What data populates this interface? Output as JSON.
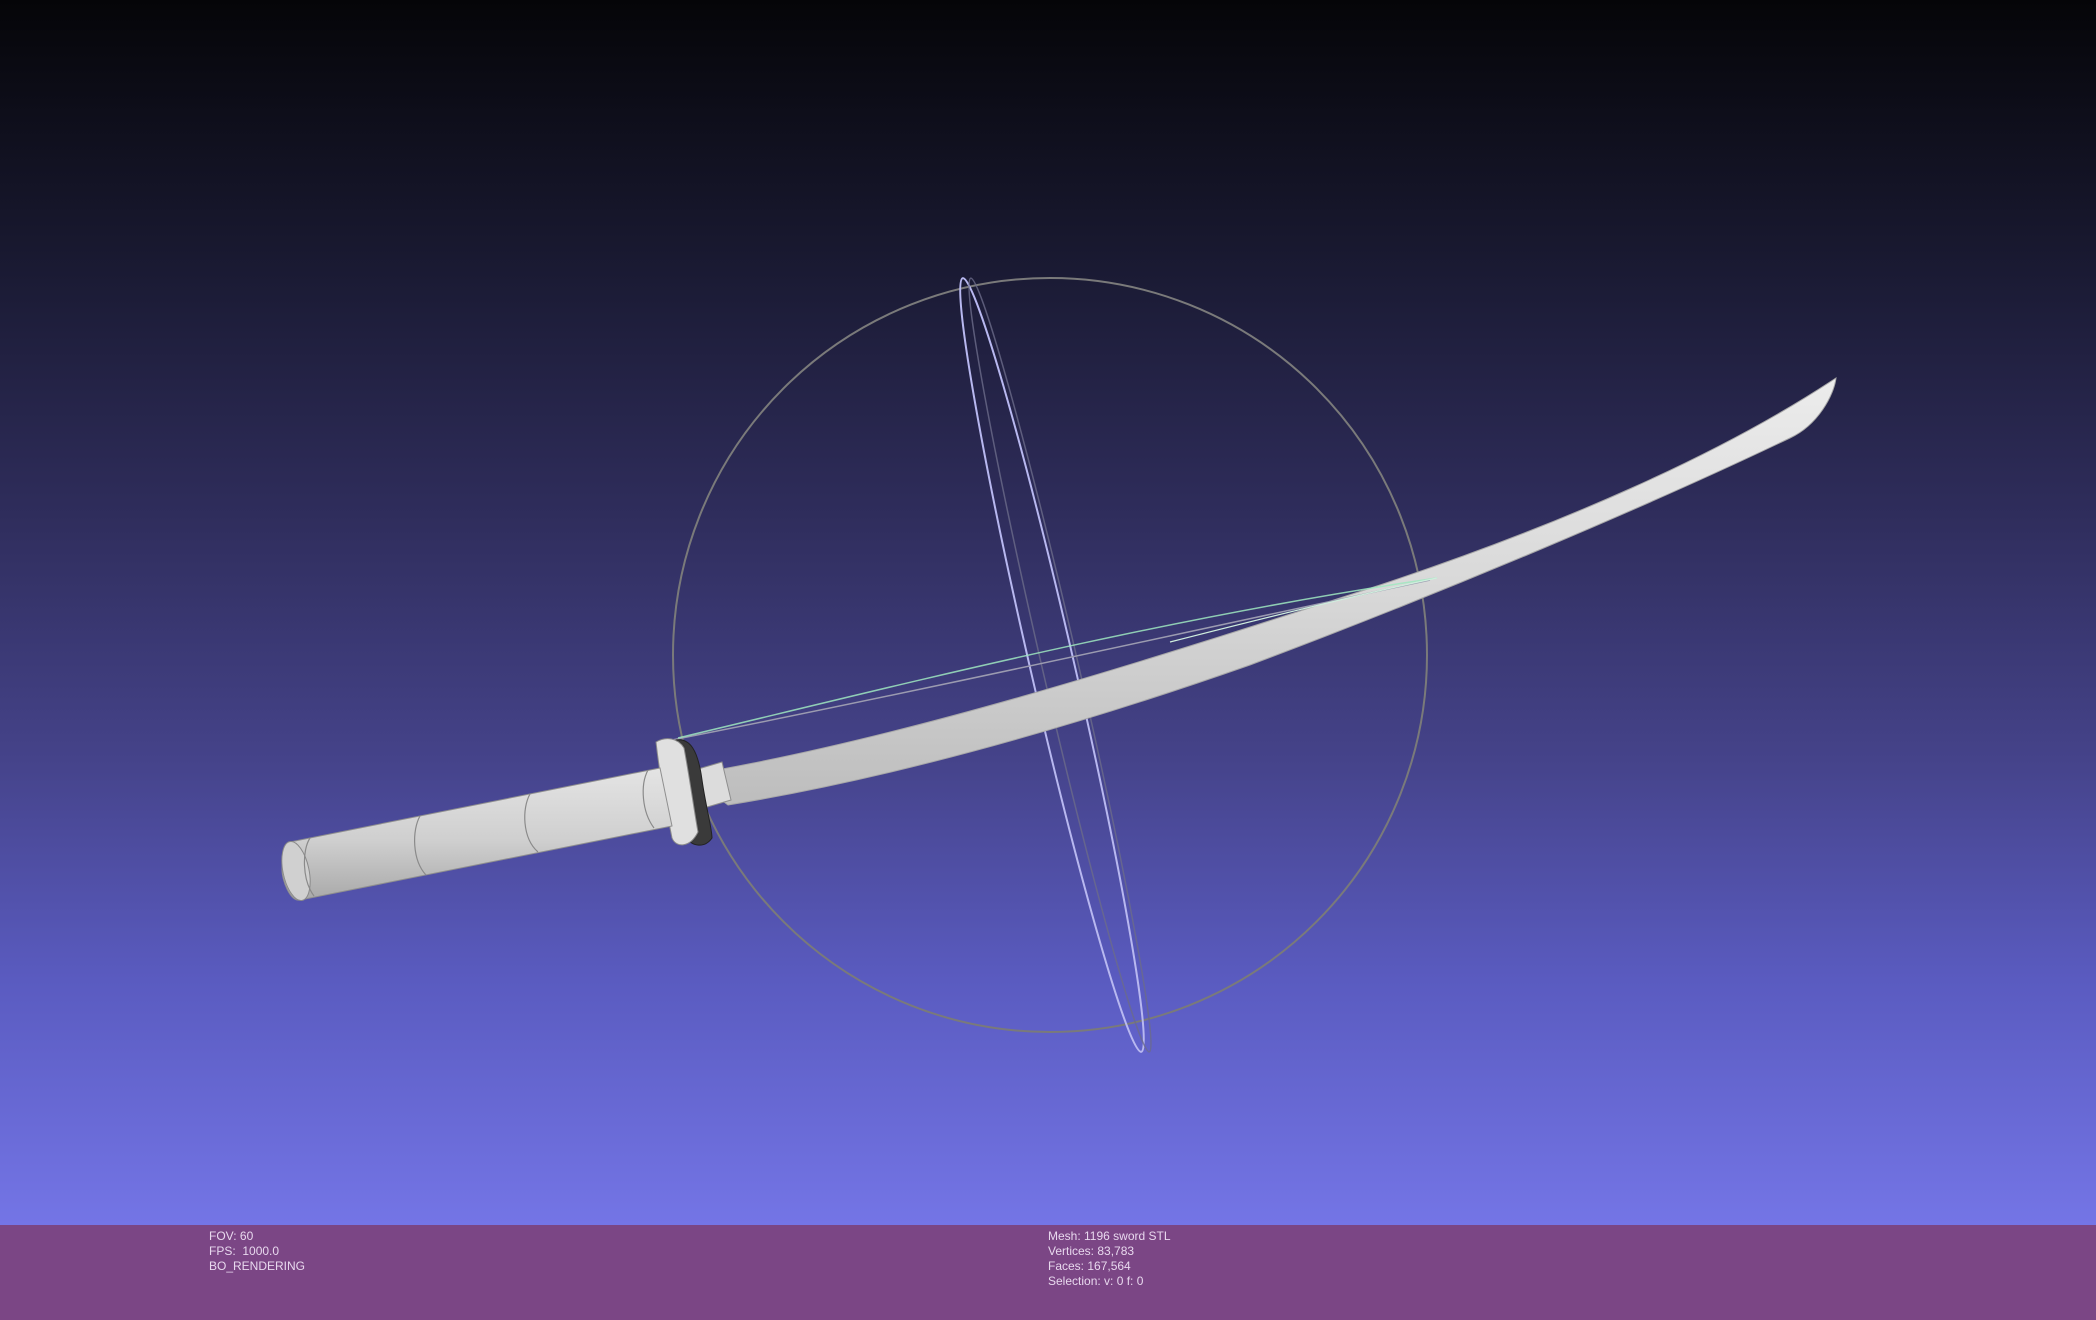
{
  "viewport": {
    "background_top": "#050508",
    "background_bottom": "#7475e6",
    "trackball_color": "#7a7a7a",
    "trackball_vertical_ring_color": "#b8b8f0",
    "mesh_color": "#d6d6d6",
    "guard_color": "#333333",
    "highlight_edge_color": "#9fe8c0"
  },
  "info_bar": {
    "background": "#7b4685",
    "left": {
      "fov": "FOV: 60",
      "fps": "FPS:  1000.0",
      "mode": "BO_RENDERING"
    },
    "right": {
      "mesh": "Mesh: 1196 sword STL",
      "vertices": "Vertices: 83,783",
      "faces": "Faces: 167,564",
      "selection": "Selection: v: 0 f: 0"
    }
  }
}
